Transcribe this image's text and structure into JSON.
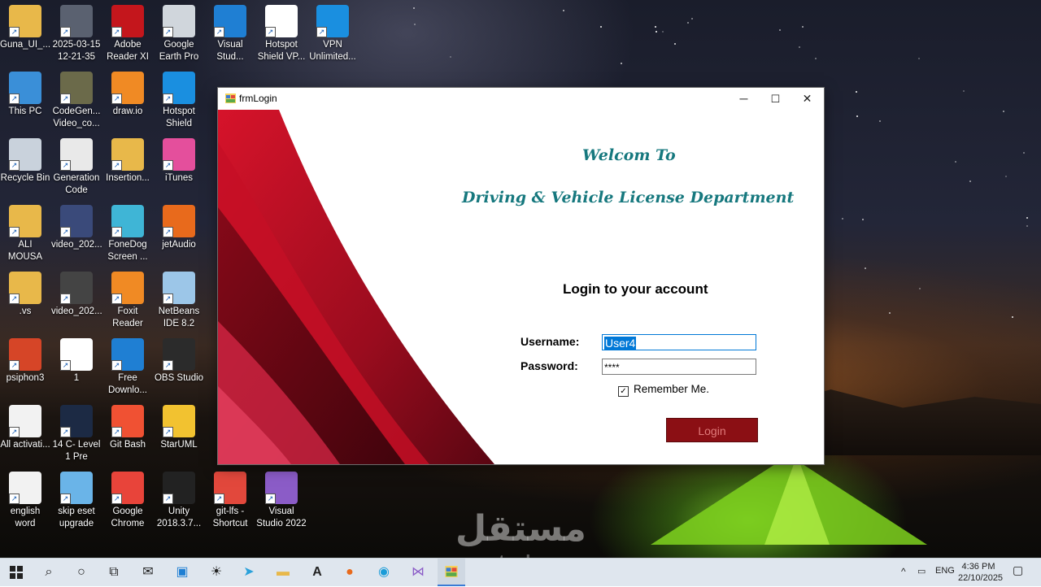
{
  "desktop": {
    "icons": [
      {
        "label": "Guna_UI_...",
        "icon": "folder-icon",
        "color": "#e8b84a"
      },
      {
        "label": "2025-03-15 12-21-35",
        "icon": "video-icon",
        "color": "#5a6170"
      },
      {
        "label": "Adobe Reader XI",
        "icon": "pdf-icon",
        "color": "#c4161c"
      },
      {
        "label": "Google Earth Pro",
        "icon": "globe-icon",
        "color": "#d0d6dc"
      },
      {
        "label": "Visual Stud...",
        "icon": "vscode-icon",
        "color": "#1f7fd3"
      },
      {
        "label": "Hotspot Shield VP...",
        "icon": "shield-icon",
        "color": "#ffffff"
      },
      {
        "label": "VPN Unlimited...",
        "icon": "vpn-icon",
        "color": "#1a8fe0"
      },
      {
        "label": "This PC",
        "icon": "computer-icon",
        "color": "#3a8fd8"
      },
      {
        "label": "CodeGen... Video_co...",
        "icon": "video-icon",
        "color": "#6b6a4a"
      },
      {
        "label": "draw.io",
        "icon": "drawio-icon",
        "color": "#f08a24"
      },
      {
        "label": "Hotspot Shield",
        "icon": "shield-icon",
        "color": "#1a8fe0"
      },
      {
        "label": "Recycle Bin",
        "icon": "recycle-bin-icon",
        "color": "#c9d2dc"
      },
      {
        "label": "Generation Code",
        "icon": "file-icon",
        "color": "#e9e9e9"
      },
      {
        "label": "Insertion...",
        "icon": "folder-icon",
        "color": "#e8b84a"
      },
      {
        "label": "iTunes",
        "icon": "music-icon",
        "color": "#e44f9c"
      },
      {
        "label": "ALI MOUSA",
        "icon": "user-folder-icon",
        "color": "#e8b84a"
      },
      {
        "label": "video_202...",
        "icon": "video-icon",
        "color": "#3a4a7a"
      },
      {
        "label": "FoneDog Screen ...",
        "icon": "record-icon",
        "color": "#3fb5d6"
      },
      {
        "label": "jetAudio",
        "icon": "audio-icon",
        "color": "#e86a1c"
      },
      {
        "label": ".vs",
        "icon": "folder-icon",
        "color": "#e8b84a"
      },
      {
        "label": "video_202...",
        "icon": "video-icon",
        "color": "#444444"
      },
      {
        "label": "Foxit Reader",
        "icon": "pdf-icon",
        "color": "#f08a24"
      },
      {
        "label": "NetBeans IDE 8.2",
        "icon": "cube-icon",
        "color": "#9cc6e8"
      },
      {
        "label": "psiphon3",
        "icon": "psiphon-icon",
        "color": "#d64527"
      },
      {
        "label": "1",
        "icon": "file-icon",
        "color": "#ffffff"
      },
      {
        "label": "Free Downlo...",
        "icon": "download-icon",
        "color": "#1f7fd3"
      },
      {
        "label": "OBS Studio",
        "icon": "obs-icon",
        "color": "#2b2b2b"
      },
      {
        "label": "All activati...",
        "icon": "file-icon",
        "color": "#f2f2f2"
      },
      {
        "label": "14 C- Level 1 Pre",
        "icon": "video-icon",
        "color": "#1c2a44"
      },
      {
        "label": "Git Bash",
        "icon": "git-icon",
        "color": "#f05133"
      },
      {
        "label": "StarUML",
        "icon": "star-icon",
        "color": "#f2c230"
      },
      {
        "label": "english word",
        "icon": "document-icon",
        "color": "#f2f2f2"
      },
      {
        "label": "skip eset upgrade",
        "icon": "file-icon",
        "color": "#6ab4e8"
      },
      {
        "label": "Google Chrome",
        "icon": "chrome-icon",
        "color": "#e8443a"
      },
      {
        "label": "Unity 2018.3.7...",
        "icon": "unity-icon",
        "color": "#222222"
      },
      {
        "label": "git-lfs - Shortcut",
        "icon": "git-lfs-icon",
        "color": "#e2483c"
      },
      {
        "label": "Visual Studio 2022",
        "icon": "visual-studio-icon",
        "color": "#8b5cc7"
      }
    ]
  },
  "window": {
    "title": "frmLogin",
    "minimize": "─",
    "maximize": "☐",
    "close": "✕",
    "welcome": "Welcom To",
    "department": "Driving & Vehicle License Department",
    "heading": "Login to your account",
    "username_label": "Username:",
    "username_value": "User4",
    "password_label": "Password:",
    "password_value": "****",
    "remember_label": "Remember Me.",
    "remember_checked": true,
    "login_button": "Login",
    "accent": "#16787e",
    "button_color": "#8b0f14"
  },
  "taskbar": {
    "language": "ENG",
    "time": "4:36 PM",
    "date": "22/10/2025"
  },
  "watermark": {
    "arabic": "مستقل",
    "latin": "mostaql.com"
  }
}
